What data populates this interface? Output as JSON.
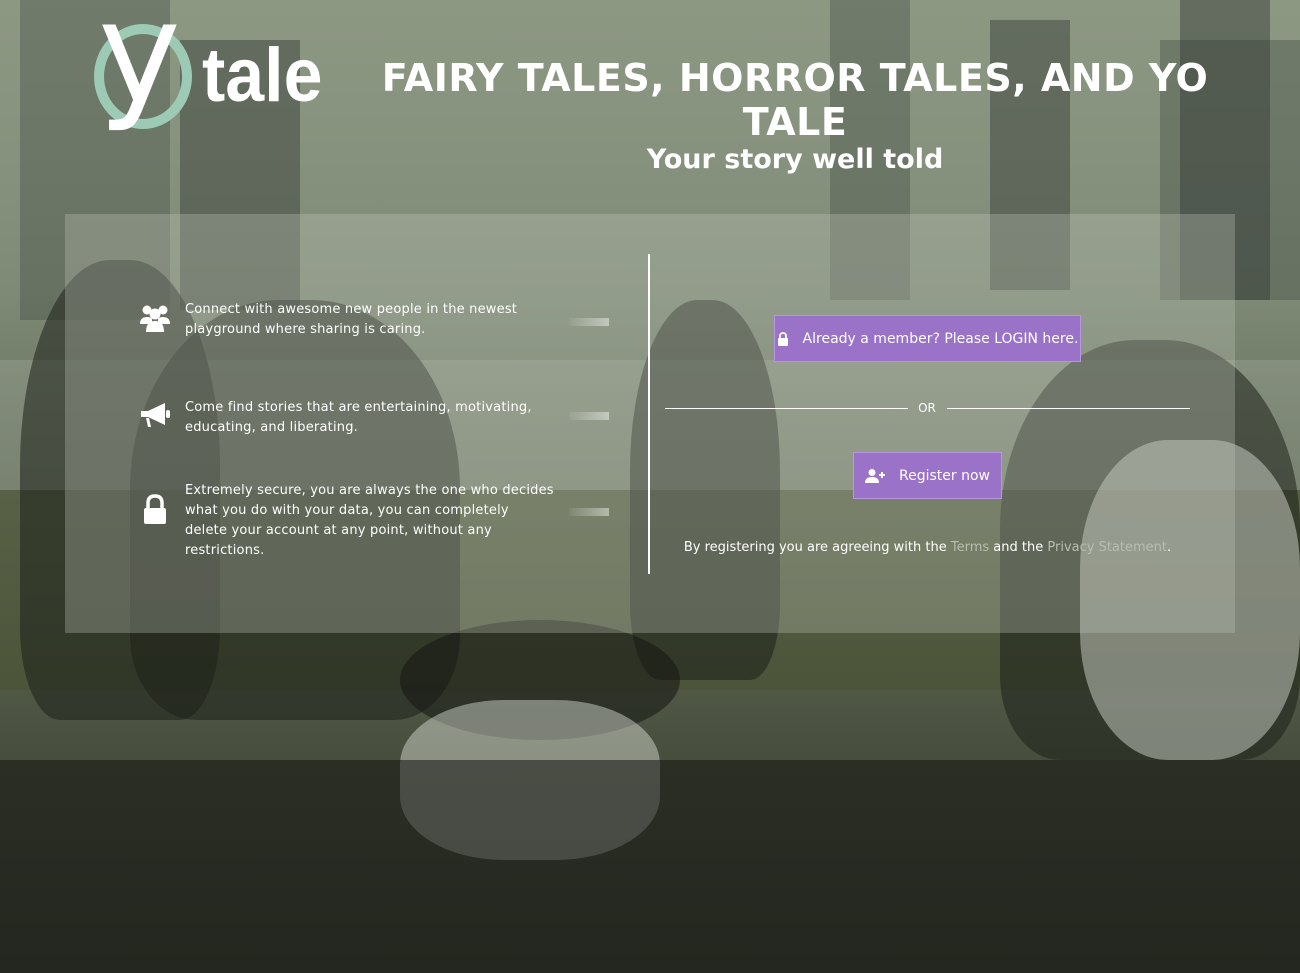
{
  "brand": {
    "logo_letter": "y",
    "logo_word": "tale",
    "circle_color": "#9ccab5"
  },
  "header": {
    "headline": "FAIRY TALES, HORROR TALES, AND YO TALE",
    "tagline": "Your story well told"
  },
  "features": [
    {
      "icon": "users-icon",
      "text": "Connect with awesome new people in the newest playground where sharing is caring."
    },
    {
      "icon": "megaphone-icon",
      "text": "Come find stories that are entertaining, motivating, educating, and liberating."
    },
    {
      "icon": "lock-icon",
      "text": "Extremely secure, you are always the one who decides what you do with your data, you can completely delete your account at any point, without any restrictions."
    }
  ],
  "auth": {
    "login_label": "Already a member? Please LOGIN here.",
    "or_label": "OR",
    "register_label": "Register now",
    "agree_prefix": "By registering you are agreeing with the",
    "terms_link": "Terms",
    "agree_middle": "and the",
    "privacy_link": "Privacy Statement",
    "agree_suffix": "."
  },
  "colors": {
    "button": "#9a73c9",
    "link": "#b8bdb1"
  }
}
